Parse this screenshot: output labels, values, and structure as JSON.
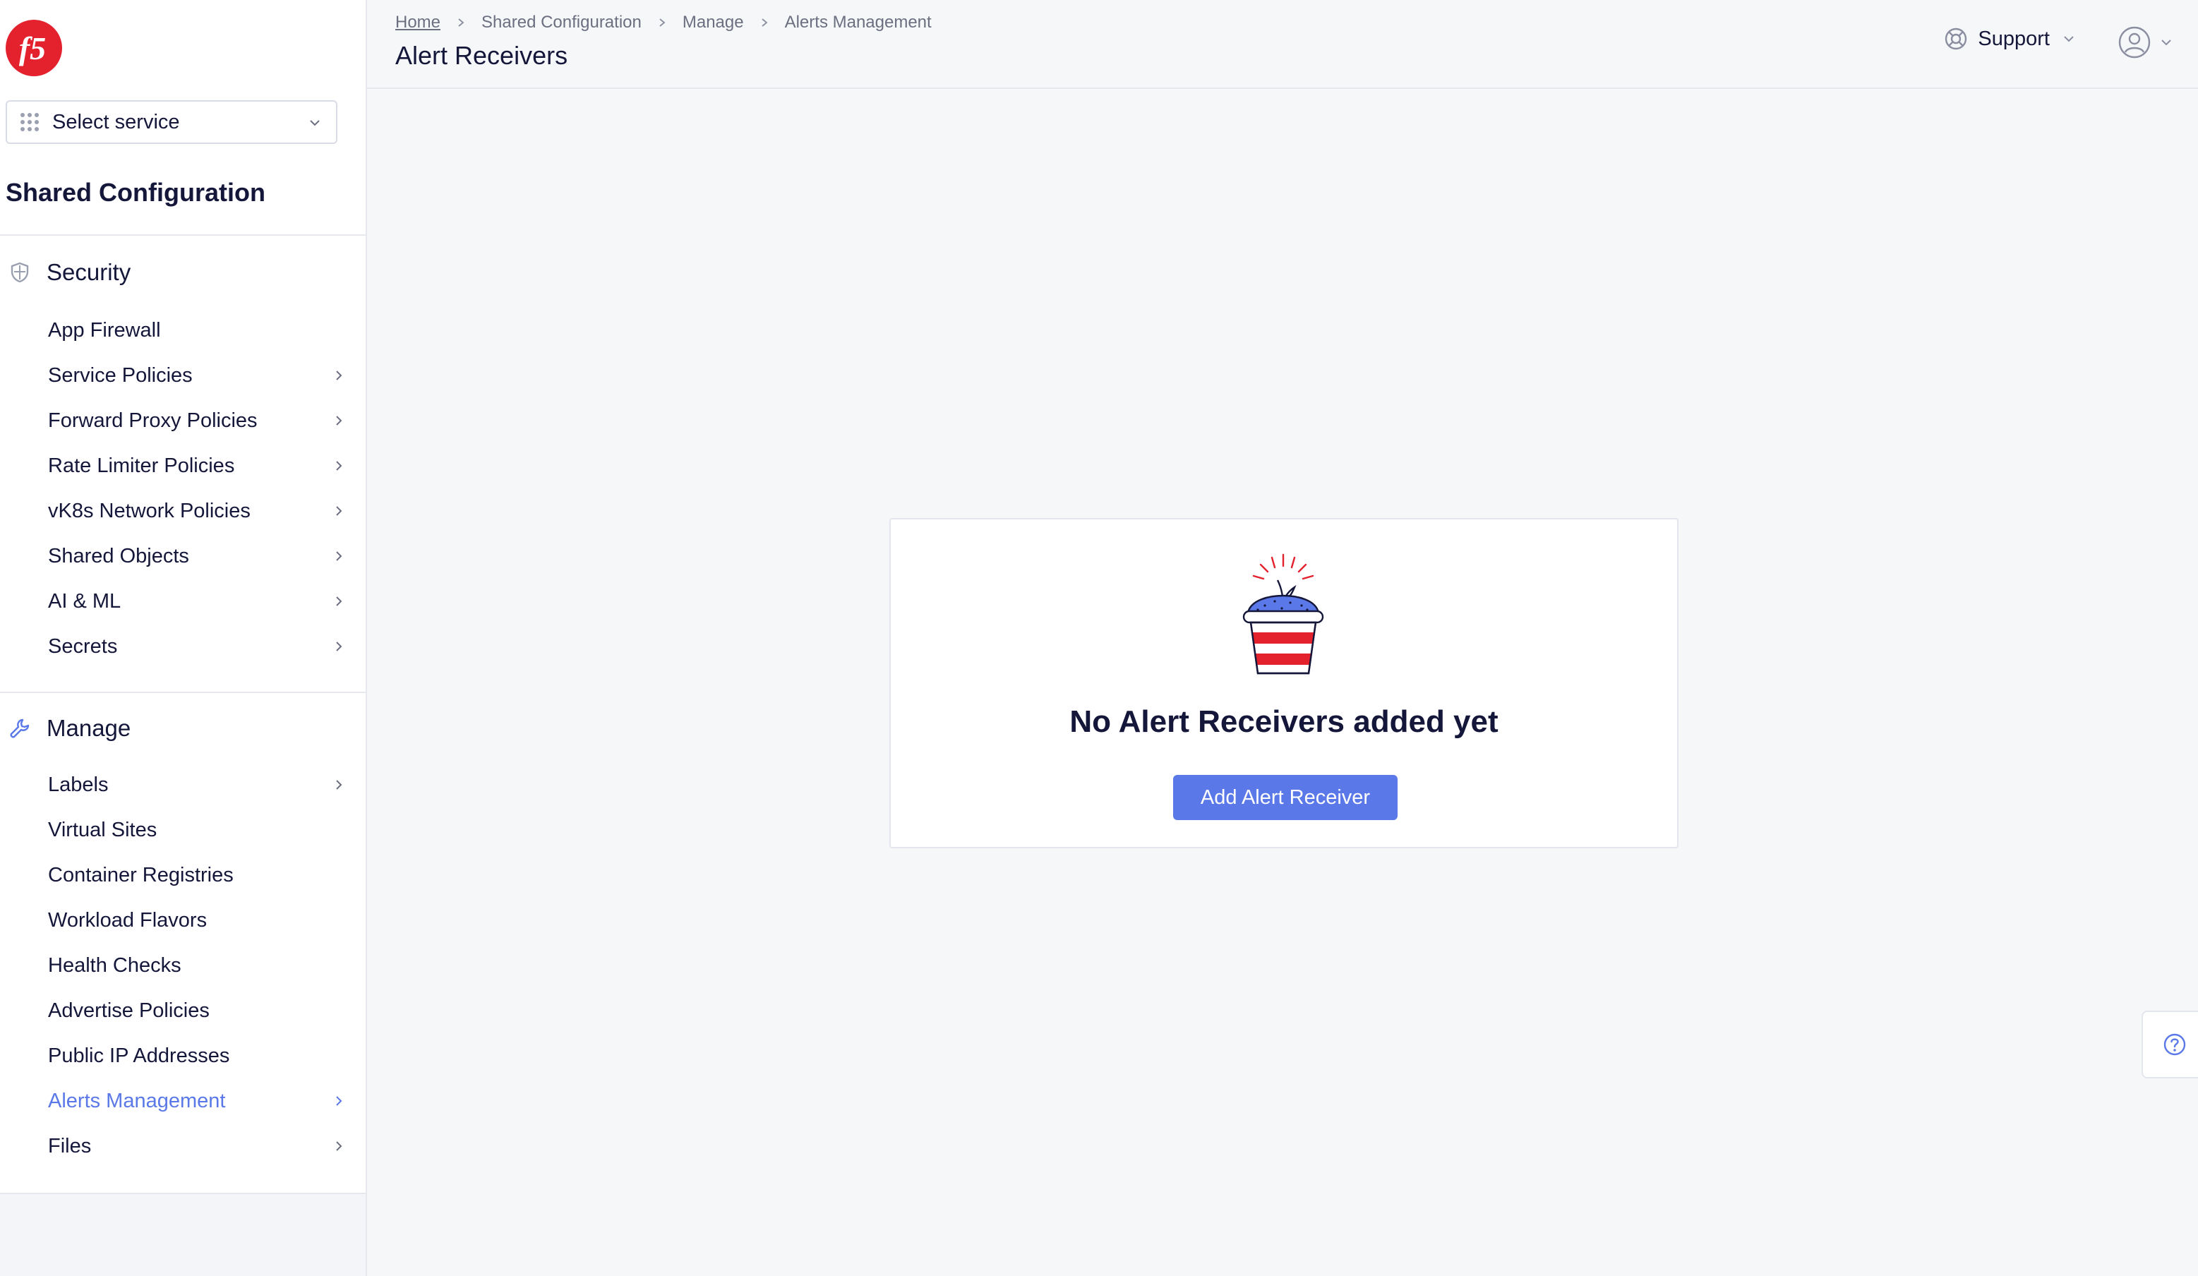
{
  "brand": {
    "logo_text": "f5",
    "accent": "#5a78e8",
    "brand_red": "#e4222e"
  },
  "sidebar": {
    "service_select": {
      "label": "Select service",
      "icon": "grid-dots-icon"
    },
    "section_title": "Shared Configuration",
    "groups": [
      {
        "title": "Security",
        "icon": "shield-icon",
        "items": [
          {
            "label": "App Firewall",
            "has_children": false
          },
          {
            "label": "Service Policies",
            "has_children": true
          },
          {
            "label": "Forward Proxy Policies",
            "has_children": true
          },
          {
            "label": "Rate Limiter Policies",
            "has_children": true
          },
          {
            "label": "vK8s Network Policies",
            "has_children": true
          },
          {
            "label": "Shared Objects",
            "has_children": true
          },
          {
            "label": "AI & ML",
            "has_children": true
          },
          {
            "label": "Secrets",
            "has_children": true
          }
        ]
      },
      {
        "title": "Manage",
        "icon": "wrench-icon",
        "items": [
          {
            "label": "Labels",
            "has_children": true
          },
          {
            "label": "Virtual Sites",
            "has_children": false
          },
          {
            "label": "Container Registries",
            "has_children": false
          },
          {
            "label": "Workload Flavors",
            "has_children": false
          },
          {
            "label": "Health Checks",
            "has_children": false
          },
          {
            "label": "Advertise Policies",
            "has_children": false
          },
          {
            "label": "Public IP Addresses",
            "has_children": false
          },
          {
            "label": "Alerts Management",
            "has_children": true,
            "active": true
          },
          {
            "label": "Files",
            "has_children": true
          }
        ]
      }
    ]
  },
  "header": {
    "breadcrumb": [
      "Home",
      "Shared Configuration",
      "Manage",
      "Alerts Management"
    ],
    "title": "Alert Receivers",
    "support_label": "Support"
  },
  "main": {
    "empty_state": {
      "title": "No Alert Receivers added yet",
      "button_label": "Add Alert Receiver",
      "illustration": "plant-pot-illustration"
    }
  },
  "help": {
    "icon": "help-circle-icon"
  }
}
